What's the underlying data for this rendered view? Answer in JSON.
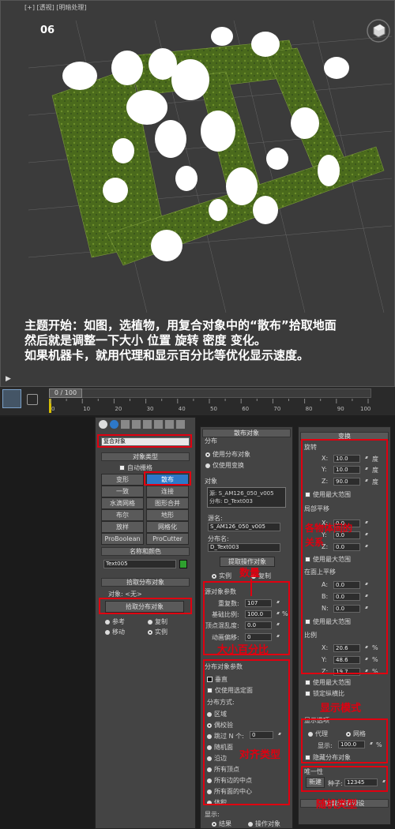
{
  "viewport": {
    "label": "[+] [透视] [明暗处理]",
    "number": "06",
    "caption": [
      "主题开始：如图，选植物，用复合对象中的“散布”拾取地面",
      "然后就是调整一下大小 位置 旋转 密度 变化。",
      "如果机器卡，就用代理和显示百分比等优化显示速度。"
    ]
  },
  "timeline": {
    "frame": "0 / 100",
    "ticks": [
      "0",
      "10",
      "20",
      "30",
      "40",
      "50",
      "60",
      "70",
      "80",
      "90",
      "100"
    ]
  },
  "command_panel": {
    "dropdown": "复合对象",
    "object_type": {
      "header": "对象类型",
      "autogrid": "自动栅格",
      "buttons": [
        "变形",
        "散布",
        "一致",
        "连接",
        "水滴网格",
        "图形合并",
        "布尔",
        "地形",
        "放样",
        "网格化",
        "ProBoolean",
        "ProCutter"
      ]
    },
    "name_color": {
      "header": "名称和颜色",
      "name": "Text005",
      "color": "#2fa02f"
    },
    "pick": {
      "header": "拾取分布对象",
      "object_label": "对象: <无>",
      "button": "拾取分布对象",
      "options": [
        "参考",
        "复制",
        "移动",
        "实例"
      ]
    }
  },
  "scatter_panel": {
    "header": "散布对象",
    "distribution": {
      "title": "分布",
      "options": [
        "使用分布对象",
        "仅使用变换"
      ]
    },
    "objects": {
      "title": "对象",
      "list": [
        "源: S_AM126_050_v005",
        "分布: D_Text003"
      ],
      "source_label": "源名:",
      "source_name": "S_AM126_050_v005",
      "dist_label": "分布名:",
      "dist_name": "D_Text003",
      "extract_button": "提取操作对象",
      "options": [
        "实例",
        "复制"
      ]
    },
    "source_params": {
      "title": "源对象参数",
      "rows": [
        {
          "label": "重复数:",
          "value": "107"
        },
        {
          "label": "基础比例:",
          "value": "100.0",
          "unit": "%"
        },
        {
          "label": "顶点混乱度:",
          "value": "0.0"
        },
        {
          "label": "动画偏移:",
          "value": "0"
        }
      ]
    },
    "dist_params": {
      "title": "分布对象参数",
      "perpendicular": "垂直",
      "selected_only": "仅使用选定面",
      "method_label": "分布方式:",
      "methods": [
        "区域",
        "偶校验",
        "跳过 N 个:",
        "随机面",
        "沿边",
        "所有顶点",
        "所有边的中点",
        "所有面的中心",
        "体积"
      ],
      "skip_value": "0"
    },
    "display": {
      "title": "显示:",
      "options": [
        "结果",
        "操作对象"
      ]
    }
  },
  "transform_panel": {
    "header": "变换",
    "rotation": {
      "title": "旋转",
      "rows": [
        {
          "axis": "X:",
          "value": "10.0",
          "unit": "度"
        },
        {
          "axis": "Y:",
          "value": "10.0",
          "unit": "度"
        },
        {
          "axis": "Z:",
          "value": "90.0",
          "unit": "度"
        }
      ],
      "max": "使用最大范围"
    },
    "local_translate": {
      "title": "局部平移",
      "rows": [
        {
          "axis": "X:",
          "value": "0.0"
        },
        {
          "axis": "Y:",
          "value": "0.0"
        },
        {
          "axis": "Z:",
          "value": "0.0"
        }
      ],
      "max": "使用最大范围"
    },
    "face_translate": {
      "title": "在面上平移",
      "rows": [
        {
          "axis": "A:",
          "value": "0.0"
        },
        {
          "axis": "B:",
          "value": "0.0"
        },
        {
          "axis": "N:",
          "value": "0.0"
        }
      ],
      "max": "使用最大范围"
    },
    "scale": {
      "title": "比例",
      "rows": [
        {
          "axis": "X:",
          "value": "20.6",
          "unit": "%"
        },
        {
          "axis": "Y:",
          "value": "48.6",
          "unit": "%"
        },
        {
          "axis": "Z:",
          "value": "19.7",
          "unit": "%"
        }
      ],
      "max": "使用最大范围",
      "lock": "锁定纵横比"
    },
    "display_opts": {
      "title": "显示选项",
      "proxy": "代理",
      "mesh": "网格",
      "display_label": "显示:",
      "display_value": "100.0",
      "unit": "%",
      "hide": "隐藏分布对象"
    },
    "unique": {
      "title": "唯一性",
      "new_button": "新建",
      "seed_label": "种子:",
      "seed": "12345"
    },
    "load_save": "加载/保存预设"
  },
  "annotations": {
    "relation": "各物体间的\n关系",
    "count": "数量",
    "size": "大小百分比",
    "align": "对齐类型",
    "display_mode": "显示模式",
    "random": "随机类型"
  }
}
